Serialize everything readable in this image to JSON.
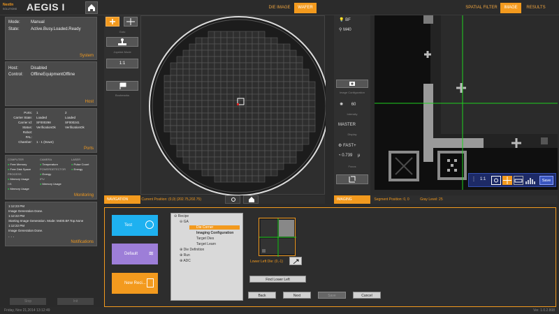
{
  "app": {
    "logo_main": "NextIn",
    "logo_sub": "SOLUTIONS",
    "title": "AEGIS I"
  },
  "topnav": {
    "die_image": "DIE IMAGE",
    "wafer": "WAFER",
    "spatial_filter": "SPATIAL FILTER",
    "image": "IMAGE",
    "results": "RESULTS"
  },
  "system": {
    "mode_label": "Mode:",
    "mode_value": "Manual",
    "state_label": "State:",
    "state_value": "Active.Busy.Loaded.Ready",
    "panel": "System"
  },
  "host": {
    "host_label": "Host:",
    "host_value": "Disabled",
    "control_label": "Control:",
    "control_value": "OfflineEquipmentOffline",
    "panel": "Host"
  },
  "ports": {
    "ports_label": "Ports:",
    "port1": "1",
    "port2": "2",
    "carrier_state_label": "Carrier State:",
    "cs1": "Loaded",
    "cs2": "Loaded",
    "carrier_id_label": "Carrier Id:",
    "cid1": "SF000298",
    "cid2": "SF000241",
    "status_label": "Status:",
    "st1": "VerificationOk",
    "st2": "VerificationOk",
    "robot_label": "Robot:",
    "pal_label": "PAL:",
    "chamber_label": "Chamber:",
    "chamber_value": "1 - 1 (Down)",
    "panel": "Ports"
  },
  "monitoring": {
    "computer": "COMPUTER",
    "camera": "CAMERA",
    "laser": "LASER",
    "free_memory": "Free Memory",
    "temperature": "Temperature",
    "pulse_count": "Pulse Count",
    "free_disk": "Free Disk Space",
    "powerdetector": "POWERDETECTOR",
    "energy": "Energy",
    "process": "PROCESS",
    "energy2": "Energy",
    "memory_usage": "Memory Usage",
    "ipu": "IPU",
    "db": "DB",
    "memory_usage2": "Memory Usage",
    "memory_usage3": "Memory Usage",
    "panel": "Monitoring"
  },
  "notifications": {
    "lines": [
      "1:12:23 PM",
      "Image Generation Done.",
      "1:12:22 PM",
      "Starting Image Generation. Mode: M400.BF.Top.None",
      "1:12:22 PM",
      "Image Generation Done."
    ],
    "ellipsis": ". . .",
    "panel": "Notifications"
  },
  "leftfooter": {
    "stop": "Stop",
    "init": "Init"
  },
  "navtool": {
    "goto": "Goto",
    "joystick": "Joystick Mode",
    "ratio": "1:1",
    "bookmarks": "Bookmarks"
  },
  "navstatus": {
    "label": "NAVIGATION",
    "position": "Current Position: (0,0) (202.75,202.75)"
  },
  "imaging": {
    "bf": "BF",
    "m40": "M40",
    "config": "Image Configuration",
    "intensity_val": "60",
    "intensity": "Intensity",
    "master": "MASTER",
    "display": "Display",
    "fast": "FAST+",
    "focus_val": "0.739",
    "focus_unit": "μ",
    "focus": "Focus"
  },
  "imgstatus": {
    "label": "IMAGING",
    "segment": "Segment Position: 0, 0",
    "gray": "Gray Level: 25"
  },
  "viewer": {
    "ratio": "1:1",
    "save": "Save"
  },
  "bottom": {
    "test": "Test",
    "default": "Default",
    "new_recipe": "New Reci...",
    "recipe_tree": {
      "recipe": "Recipe",
      "ga": "GA",
      "die_corner": "Die Corner",
      "imaging_config": "Imaging Configuration",
      "target_dies": "Target Dies",
      "target_learn": "Target Learn",
      "die_definition": "Die Definition",
      "run": "Run",
      "adc": "ADC"
    },
    "lower_left": "Lower Left Die: (0,-1)",
    "find_lower_left": "Find Lower Left",
    "back": "Back",
    "next": "Next",
    "save": "Save",
    "cancel": "Cancel"
  },
  "footer": {
    "datetime": "Friday, Nov 21,2014 13:12:49",
    "version": "Ver. 1.0.2.808"
  },
  "colors": {
    "accent": "#f39a1e",
    "green": "#2fd14a",
    "blue": "#2aa7e6",
    "purple": "#9a79d9"
  }
}
